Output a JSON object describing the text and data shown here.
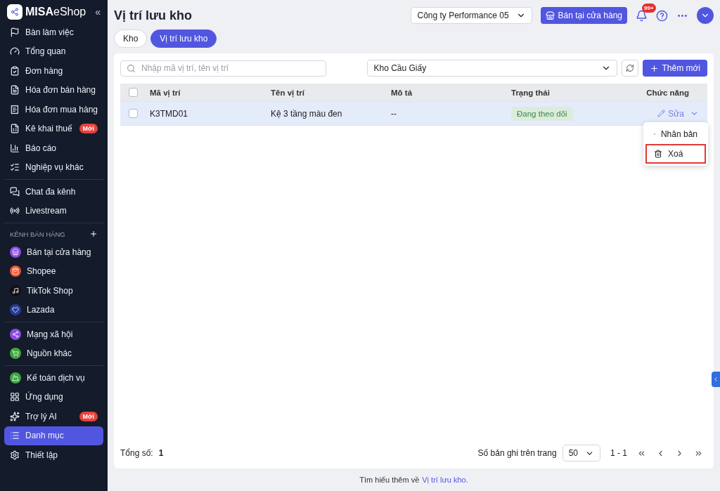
{
  "sidebar": {
    "brand": {
      "bold": "MISA",
      "light": "eShop"
    },
    "collapse": "«",
    "sections": [
      {
        "items": [
          {
            "label": "Bàn làm việc",
            "selected": false
          },
          {
            "label": "Tổng quan",
            "selected": false
          },
          {
            "label": "Đơn hàng",
            "selected": false
          },
          {
            "label": "Hóa đơn bán hàng",
            "selected": false
          },
          {
            "label": "Hóa đơn mua hàng",
            "selected": false
          },
          {
            "label": "Kê khai thuế",
            "badge": "Mới",
            "selected": false
          },
          {
            "label": "Báo cáo",
            "selected": false
          },
          {
            "label": "Nghiệp vụ khác",
            "selected": false
          }
        ]
      },
      {
        "items": [
          {
            "label": "Chat đa kênh",
            "selected": false
          },
          {
            "label": "Livestream",
            "selected": false
          }
        ]
      },
      {
        "title": "KÊNH BÁN HÀNG",
        "items": [
          {
            "label": "Bán tại cửa hàng",
            "selected": false
          },
          {
            "label": "Shopee",
            "selected": false
          },
          {
            "label": "TikTok Shop",
            "selected": false
          },
          {
            "label": "Lazada",
            "selected": false
          }
        ]
      },
      {
        "items": [
          {
            "label": "Mạng xã hội",
            "selected": false
          },
          {
            "label": "Nguồn khác",
            "selected": false
          }
        ]
      },
      {
        "items": [
          {
            "label": "Kế toán dịch vụ",
            "selected": false
          },
          {
            "label": "Ứng dụng",
            "selected": false
          },
          {
            "label": "Trợ lý AI",
            "badge": "Mới",
            "selected": false
          },
          {
            "label": "Danh mục",
            "selected": true
          },
          {
            "label": "Thiết lập",
            "selected": false
          }
        ]
      }
    ]
  },
  "header": {
    "title": "Vị trí lưu kho",
    "company": "Công ty Performance 05",
    "store_button": "Bán tại cửa hàng",
    "notifications": "99+"
  },
  "tabs": [
    {
      "label": "Kho",
      "selected": false
    },
    {
      "label": "Vị trí lưu kho",
      "selected": true
    }
  ],
  "toolbar": {
    "search_placeholder": "Nhập mã vị trí, tên vị trí",
    "warehouse": "Kho Cầu Giấy",
    "add_button": "Thêm mới"
  },
  "table": {
    "columns": [
      "Mã vị trí",
      "Tên vị trí",
      "Mô tả",
      "Trạng thái",
      "Chức năng"
    ],
    "header_checked": false,
    "rows": [
      {
        "code": "K3TMD01",
        "name": "Kệ 3 tầng màu đen",
        "description": "--",
        "status": "Đang theo dõi",
        "action": "Sửa",
        "checked": false,
        "highlighted": true
      }
    ]
  },
  "menu": [
    {
      "label": "Nhân bản",
      "focused": false
    },
    {
      "label": "Xoá",
      "focused": true
    }
  ],
  "footer": {
    "total_label": "Tổng số:",
    "total": "1",
    "per_page_label": "Số bản ghi trên trang",
    "per_page": "50",
    "range": "1 - 1"
  },
  "help": {
    "text": "Tìm hiểu thêm về",
    "link": "Vị trí lưu kho."
  }
}
